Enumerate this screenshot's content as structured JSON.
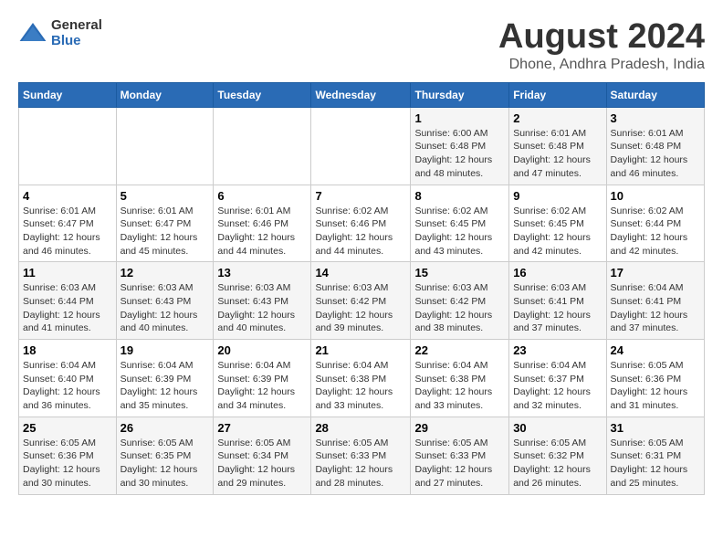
{
  "logo": {
    "general": "General",
    "blue": "Blue"
  },
  "title": {
    "main": "August 2024",
    "sub": "Dhone, Andhra Pradesh, India"
  },
  "header_days": [
    "Sunday",
    "Monday",
    "Tuesday",
    "Wednesday",
    "Thursday",
    "Friday",
    "Saturday"
  ],
  "weeks": [
    [
      {
        "day": "",
        "info": ""
      },
      {
        "day": "",
        "info": ""
      },
      {
        "day": "",
        "info": ""
      },
      {
        "day": "",
        "info": ""
      },
      {
        "day": "1",
        "info": "Sunrise: 6:00 AM\nSunset: 6:48 PM\nDaylight: 12 hours and 48 minutes."
      },
      {
        "day": "2",
        "info": "Sunrise: 6:01 AM\nSunset: 6:48 PM\nDaylight: 12 hours and 47 minutes."
      },
      {
        "day": "3",
        "info": "Sunrise: 6:01 AM\nSunset: 6:48 PM\nDaylight: 12 hours and 46 minutes."
      }
    ],
    [
      {
        "day": "4",
        "info": "Sunrise: 6:01 AM\nSunset: 6:47 PM\nDaylight: 12 hours and 46 minutes."
      },
      {
        "day": "5",
        "info": "Sunrise: 6:01 AM\nSunset: 6:47 PM\nDaylight: 12 hours and 45 minutes."
      },
      {
        "day": "6",
        "info": "Sunrise: 6:01 AM\nSunset: 6:46 PM\nDaylight: 12 hours and 44 minutes."
      },
      {
        "day": "7",
        "info": "Sunrise: 6:02 AM\nSunset: 6:46 PM\nDaylight: 12 hours and 44 minutes."
      },
      {
        "day": "8",
        "info": "Sunrise: 6:02 AM\nSunset: 6:45 PM\nDaylight: 12 hours and 43 minutes."
      },
      {
        "day": "9",
        "info": "Sunrise: 6:02 AM\nSunset: 6:45 PM\nDaylight: 12 hours and 42 minutes."
      },
      {
        "day": "10",
        "info": "Sunrise: 6:02 AM\nSunset: 6:44 PM\nDaylight: 12 hours and 42 minutes."
      }
    ],
    [
      {
        "day": "11",
        "info": "Sunrise: 6:03 AM\nSunset: 6:44 PM\nDaylight: 12 hours and 41 minutes."
      },
      {
        "day": "12",
        "info": "Sunrise: 6:03 AM\nSunset: 6:43 PM\nDaylight: 12 hours and 40 minutes."
      },
      {
        "day": "13",
        "info": "Sunrise: 6:03 AM\nSunset: 6:43 PM\nDaylight: 12 hours and 40 minutes."
      },
      {
        "day": "14",
        "info": "Sunrise: 6:03 AM\nSunset: 6:42 PM\nDaylight: 12 hours and 39 minutes."
      },
      {
        "day": "15",
        "info": "Sunrise: 6:03 AM\nSunset: 6:42 PM\nDaylight: 12 hours and 38 minutes."
      },
      {
        "day": "16",
        "info": "Sunrise: 6:03 AM\nSunset: 6:41 PM\nDaylight: 12 hours and 37 minutes."
      },
      {
        "day": "17",
        "info": "Sunrise: 6:04 AM\nSunset: 6:41 PM\nDaylight: 12 hours and 37 minutes."
      }
    ],
    [
      {
        "day": "18",
        "info": "Sunrise: 6:04 AM\nSunset: 6:40 PM\nDaylight: 12 hours and 36 minutes."
      },
      {
        "day": "19",
        "info": "Sunrise: 6:04 AM\nSunset: 6:39 PM\nDaylight: 12 hours and 35 minutes."
      },
      {
        "day": "20",
        "info": "Sunrise: 6:04 AM\nSunset: 6:39 PM\nDaylight: 12 hours and 34 minutes."
      },
      {
        "day": "21",
        "info": "Sunrise: 6:04 AM\nSunset: 6:38 PM\nDaylight: 12 hours and 33 minutes."
      },
      {
        "day": "22",
        "info": "Sunrise: 6:04 AM\nSunset: 6:38 PM\nDaylight: 12 hours and 33 minutes."
      },
      {
        "day": "23",
        "info": "Sunrise: 6:04 AM\nSunset: 6:37 PM\nDaylight: 12 hours and 32 minutes."
      },
      {
        "day": "24",
        "info": "Sunrise: 6:05 AM\nSunset: 6:36 PM\nDaylight: 12 hours and 31 minutes."
      }
    ],
    [
      {
        "day": "25",
        "info": "Sunrise: 6:05 AM\nSunset: 6:36 PM\nDaylight: 12 hours and 30 minutes."
      },
      {
        "day": "26",
        "info": "Sunrise: 6:05 AM\nSunset: 6:35 PM\nDaylight: 12 hours and 30 minutes."
      },
      {
        "day": "27",
        "info": "Sunrise: 6:05 AM\nSunset: 6:34 PM\nDaylight: 12 hours and 29 minutes."
      },
      {
        "day": "28",
        "info": "Sunrise: 6:05 AM\nSunset: 6:33 PM\nDaylight: 12 hours and 28 minutes."
      },
      {
        "day": "29",
        "info": "Sunrise: 6:05 AM\nSunset: 6:33 PM\nDaylight: 12 hours and 27 minutes."
      },
      {
        "day": "30",
        "info": "Sunrise: 6:05 AM\nSunset: 6:32 PM\nDaylight: 12 hours and 26 minutes."
      },
      {
        "day": "31",
        "info": "Sunrise: 6:05 AM\nSunset: 6:31 PM\nDaylight: 12 hours and 25 minutes."
      }
    ]
  ]
}
